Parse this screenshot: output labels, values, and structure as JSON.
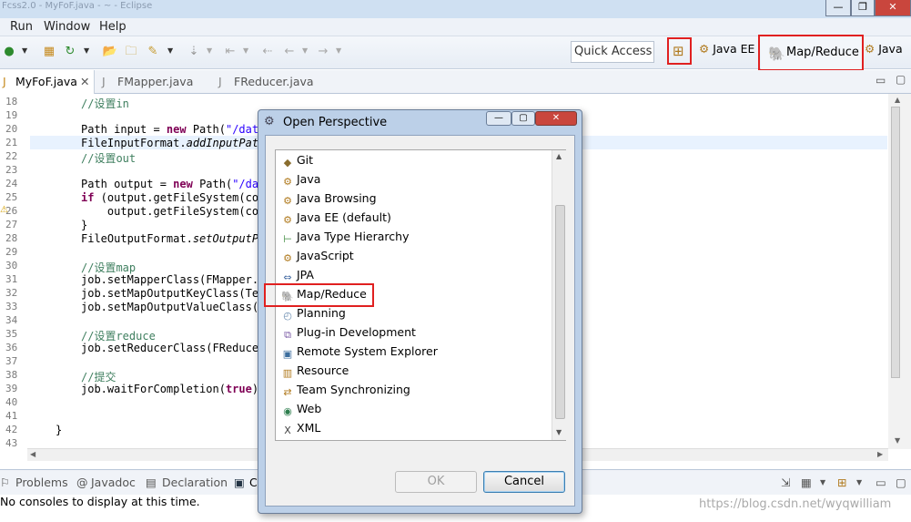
{
  "window": {
    "title": "Fcss2.0 - MyFoF.java - ~ - Eclipse",
    "minimize": "—",
    "restore": "❐",
    "close": "✕"
  },
  "menu": {
    "items": [
      "Run",
      "Window",
      "Help"
    ]
  },
  "toolbar": {
    "quick_access_placeholder": "Quick Access"
  },
  "perspectives": {
    "java_ee": "Java EE",
    "map_reduce": "Map/Reduce",
    "java": "Java"
  },
  "editor": {
    "tabs": [
      "MyFoF.java",
      "FMapper.java",
      "FReducer.java"
    ],
    "line_numbers": [
      "18",
      "19",
      "20",
      "21",
      "22",
      "23",
      "24",
      "25",
      "26",
      "27",
      "28",
      "29",
      "30",
      "31",
      "32",
      "33",
      "34",
      "35",
      "36",
      "37",
      "38",
      "39",
      "40",
      "41",
      "42",
      "43"
    ],
    "code": {
      "l18": "//设置in",
      "l20a": "Path input = ",
      "l20kw": "new",
      "l20b": " Path(",
      "l20s": "\"/data",
      "l21": "FileInputFormat.",
      "l21i": "addInputPath",
      "l22": "//设置out",
      "l24a": "Path output = ",
      "l24kw": "new",
      "l24b": " Path(",
      "l24s": "\"/dat",
      "l25kw": "if",
      "l25": " (output.getFileSystem(con",
      "l26": "    output.getFileSystem(con",
      "l27": "}",
      "l28": "FileOutputFormat.",
      "l28i": "setOutputPa",
      "l30": "//设置map",
      "l31": "job.setMapperClass(FMapper.c",
      "l32": "job.setMapOutputKeyClass(Tex",
      "l33": "job.setMapOutputValueClass(I",
      "l35": "//设置reduce",
      "l36": "job.setReducerClass(FReducer",
      "l38": "//提交",
      "l39a": "job.waitForCompletion(",
      "l39kw": "true",
      "l39b": ");",
      "l42": "}"
    }
  },
  "bottom": {
    "tabs": [
      "Problems",
      "Javadoc",
      "Declaration",
      "C"
    ],
    "console_message": "No consoles to display at this time."
  },
  "watermark": "https://blog.csdn.net/wyqwilliam",
  "dialog": {
    "title": "Open Perspective",
    "items": [
      {
        "label": "Git",
        "icon": "git-icon"
      },
      {
        "label": "Java",
        "icon": "java-icon"
      },
      {
        "label": "Java Browsing",
        "icon": "java-browsing-icon"
      },
      {
        "label": "Java EE (default)",
        "icon": "java-ee-icon"
      },
      {
        "label": "Java Type Hierarchy",
        "icon": "type-hierarchy-icon"
      },
      {
        "label": "JavaScript",
        "icon": "javascript-icon"
      },
      {
        "label": "JPA",
        "icon": "jpa-icon"
      },
      {
        "label": "Map/Reduce",
        "icon": "elephant-icon"
      },
      {
        "label": "Planning",
        "icon": "planning-icon"
      },
      {
        "label": "Plug-in Development",
        "icon": "plugin-icon"
      },
      {
        "label": "Remote System Explorer",
        "icon": "remote-icon"
      },
      {
        "label": "Resource",
        "icon": "resource-icon"
      },
      {
        "label": "Team Synchronizing",
        "icon": "team-sync-icon"
      },
      {
        "label": "Web",
        "icon": "web-icon"
      },
      {
        "label": "XML",
        "icon": "xml-icon"
      }
    ],
    "ok_label": "OK",
    "cancel_label": "Cancel"
  },
  "colors": {
    "highlight": "#e02020",
    "keyword": "#7f0055",
    "comment": "#3f7f5f",
    "string": "#2a00ff"
  }
}
